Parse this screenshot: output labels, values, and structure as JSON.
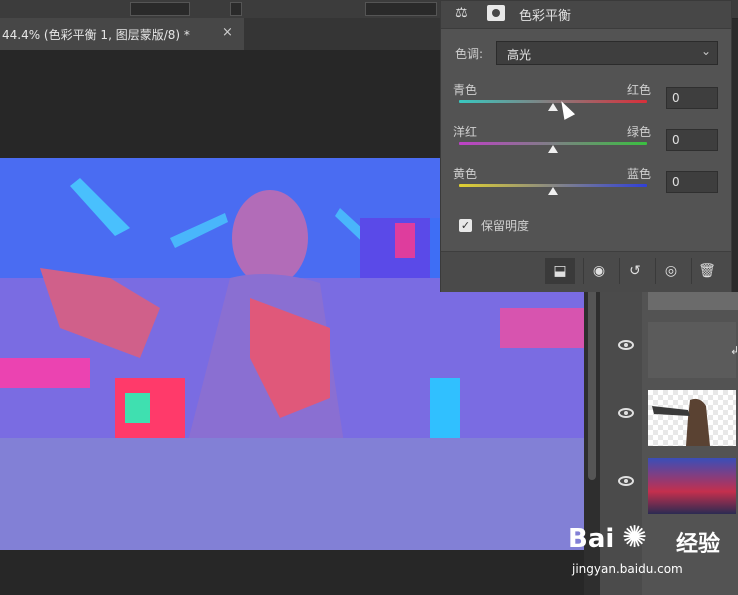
{
  "document_tab": {
    "title": "44.4% (色彩平衡 1, 图层蒙版/8) *",
    "close_icon": "×"
  },
  "properties": {
    "title": "色彩平衡",
    "icons": [
      "balance-icon",
      "mask-icon"
    ],
    "tone": {
      "label": "色调:",
      "value": "高光"
    },
    "sliders": [
      {
        "left": "青色",
        "right": "红色",
        "value": "0",
        "level_fraction": 0.5,
        "gradient": [
          "#38c8c0",
          "#d82f3a"
        ]
      },
      {
        "left": "洋红",
        "right": "绿色",
        "value": "0",
        "level_fraction": 0.5,
        "gradient": [
          "#c040c8",
          "#3ac040"
        ]
      },
      {
        "left": "黄色",
        "right": "蓝色",
        "value": "0",
        "level_fraction": 0.5,
        "gradient": [
          "#e0d030",
          "#3040d8"
        ]
      }
    ],
    "preserve_luminosity": {
      "label": "保留明度",
      "checked": true
    },
    "footer_icons": [
      "clip-to-layer-icon",
      "view-previous-state-icon",
      "reset-icon",
      "visibility-icon",
      "delete-icon"
    ]
  },
  "layers": [
    {
      "name": "color-balance-adjustment",
      "visible": true
    },
    {
      "name": "person-layer",
      "visible": true
    },
    {
      "name": "background-scene",
      "visible": true
    }
  ],
  "watermark": {
    "brand": "Bai",
    "brand_suffix": "经验",
    "url": "jingyan.baidu.com"
  }
}
